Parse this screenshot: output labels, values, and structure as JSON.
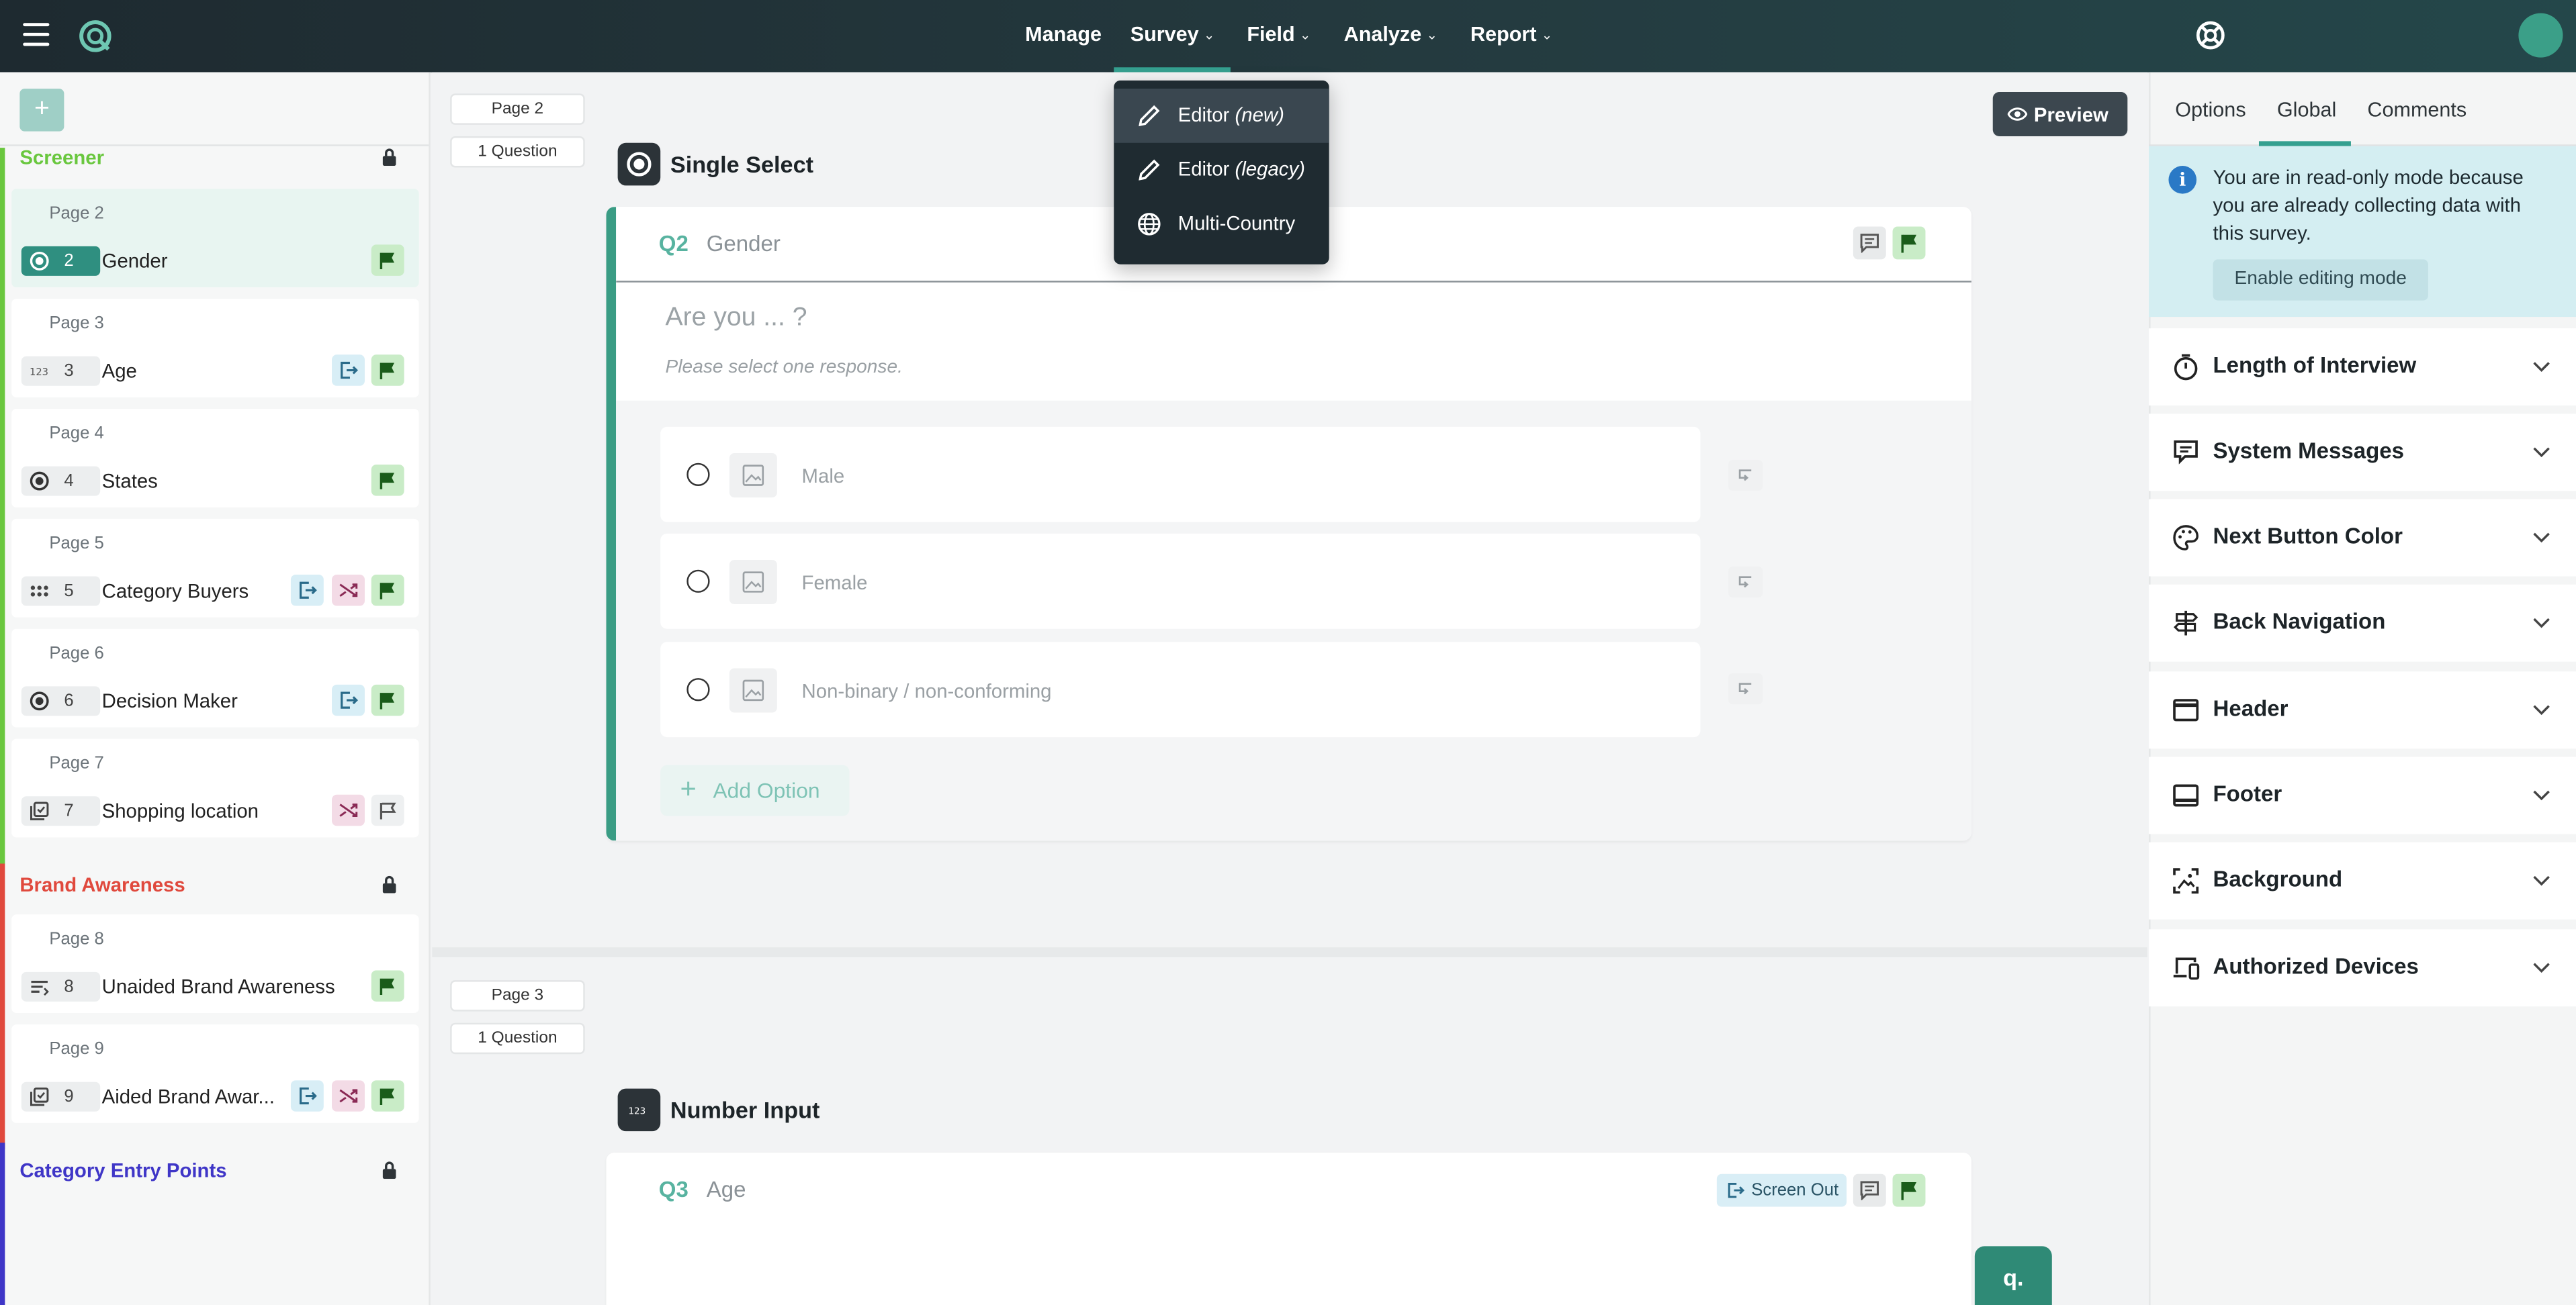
{
  "topbar": {
    "nav": [
      {
        "label": "Manage",
        "has_menu": false
      },
      {
        "label": "Survey",
        "has_menu": true
      },
      {
        "label": "Field",
        "has_menu": true
      },
      {
        "label": "Analyze",
        "has_menu": true
      },
      {
        "label": "Report",
        "has_menu": true
      }
    ]
  },
  "survey_menu": {
    "items": [
      {
        "label": "Editor",
        "suffix": "(new)",
        "icon": "pencil-icon"
      },
      {
        "label": "Editor",
        "suffix": "(legacy)",
        "icon": "pencil-icon"
      },
      {
        "label": "Multi-Country",
        "suffix": "",
        "icon": "globe-icon"
      }
    ]
  },
  "sidebar": {
    "add_label": "+",
    "sections": [
      {
        "title": "Screener",
        "color": "#69c73e"
      },
      {
        "title": "Brand Awareness",
        "color": "#e0493d"
      },
      {
        "title": "Category Entry Points",
        "color": "#3f36c7"
      }
    ],
    "pages": [
      {
        "page": "Page 2",
        "num": "2",
        "name": "Gender"
      },
      {
        "page": "Page 3",
        "num": "3",
        "name": "Age"
      },
      {
        "page": "Page 4",
        "num": "4",
        "name": "States"
      },
      {
        "page": "Page 5",
        "num": "5",
        "name": "Category Buyers"
      },
      {
        "page": "Page 6",
        "num": "6",
        "name": "Decision Maker"
      },
      {
        "page": "Page 7",
        "num": "7",
        "name": "Shopping location"
      },
      {
        "page": "Page 8",
        "num": "8",
        "name": "Unaided Brand Awareness"
      },
      {
        "page": "Page 9",
        "num": "9",
        "name": "Aided Brand Awar..."
      }
    ]
  },
  "main": {
    "preview_label": "Preview",
    "page_a": {
      "page": "Page 2",
      "count": "1 Question",
      "type": "Single Select"
    },
    "q2": {
      "num": "Q2",
      "title": "Gender",
      "text": "Are you ... ?",
      "hint": "Please select one response.",
      "options": [
        "Male",
        "Female",
        "Non-binary / non-conforming"
      ],
      "add_option": "Add Option"
    },
    "page_b": {
      "page": "Page 3",
      "count": "1 Question",
      "type": "Number Input"
    },
    "q3": {
      "num": "Q3",
      "title": "Age",
      "screen_out": "Screen Out"
    },
    "chat_label": "q."
  },
  "right": {
    "tabs": [
      "Options",
      "Global",
      "Comments"
    ],
    "active_tab": "Global",
    "info": {
      "text": "You are in read-only mode because you are already collecting data with this survey.",
      "button": "Enable editing mode"
    },
    "accordions": [
      "Length of Interview",
      "System Messages",
      "Next Button Color",
      "Back Navigation",
      "Header",
      "Footer",
      "Background",
      "Authorized Devices"
    ]
  },
  "colors": {
    "accent": "#35a090",
    "topbar": "#203238",
    "screener": "#69c73e",
    "brand_awareness": "#e0493d",
    "category_entry": "#3f36c7"
  }
}
